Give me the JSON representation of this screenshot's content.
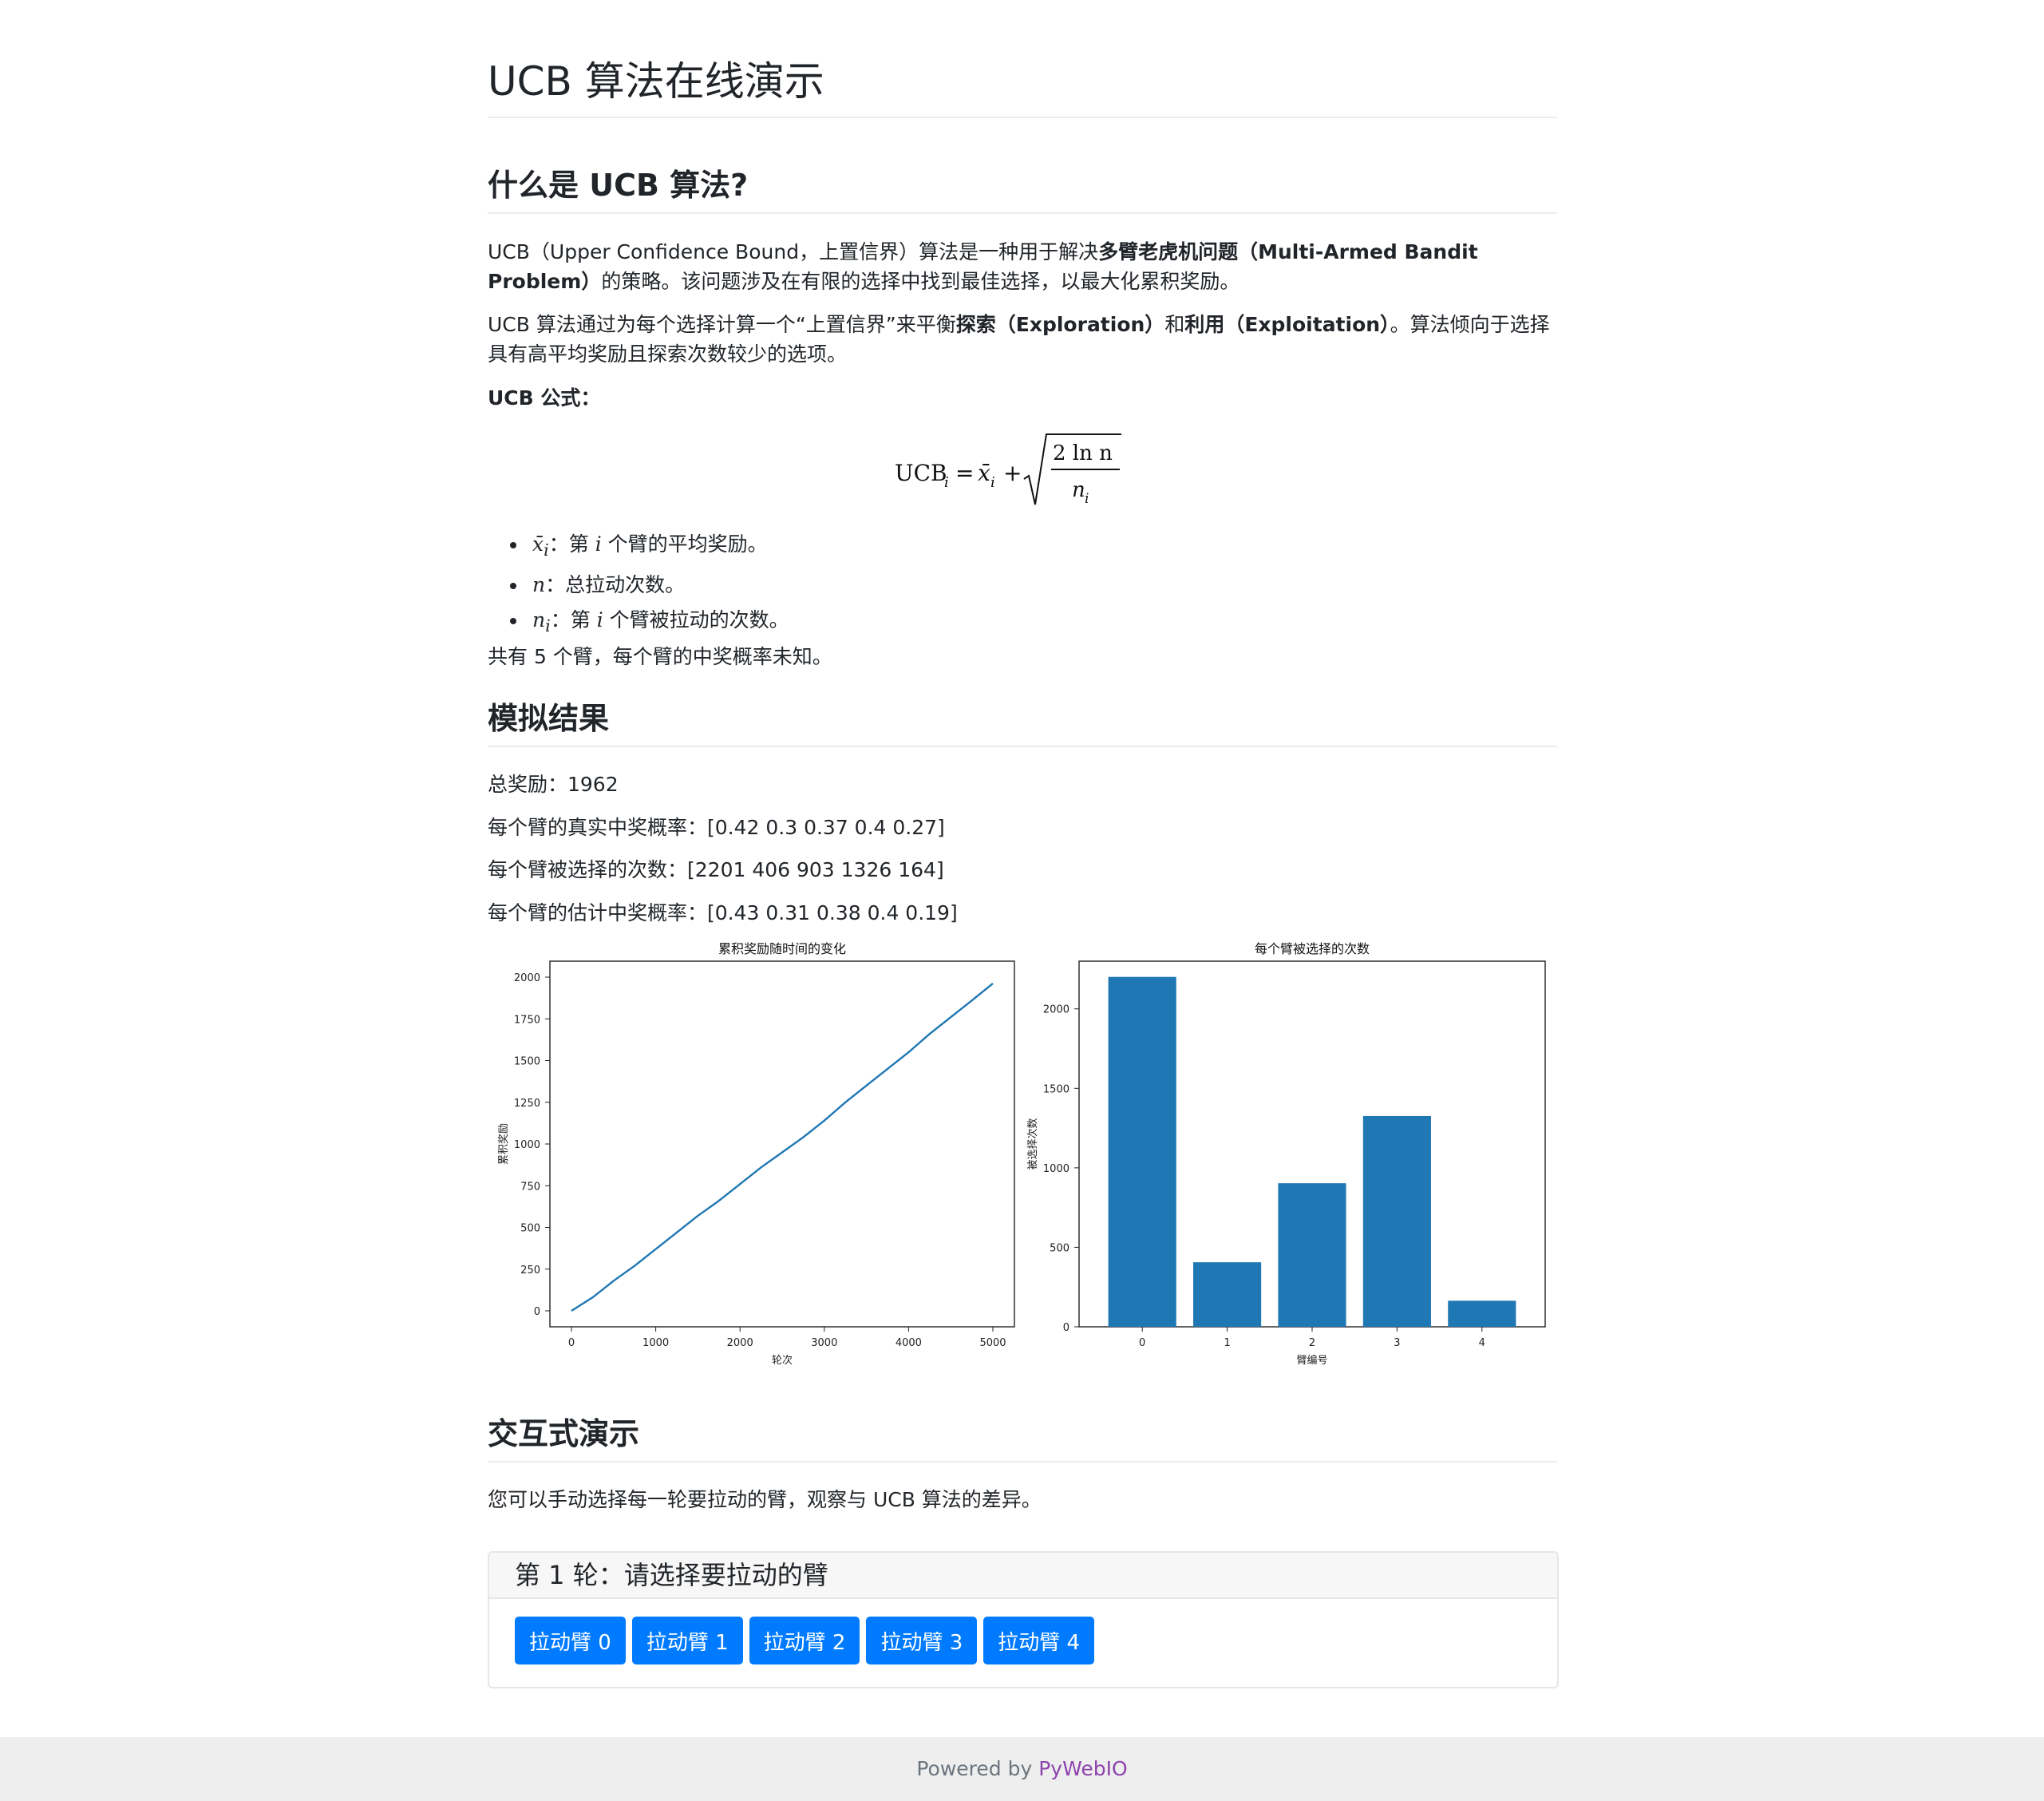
{
  "header": {
    "title": "UCB 算法在线演示"
  },
  "intro": {
    "heading": "什么是 UCB 算法?",
    "p1_a": "UCB（Upper Confidence Bound，上置信界）算法是一种用于解决",
    "p1_bold": "多臂老虎机问题（Multi-Armed Bandit Problem）",
    "p1_b": "的策略。该问题涉及在有限的选择中找到最佳选择，以最大化累积奖励。",
    "p2_a": "UCB 算法通过为每个选择计算一个“上置信界”来平衡",
    "p2_bold1": "探索（Exploration）",
    "p2_b": "和",
    "p2_bold2": "利用（Exploitation）",
    "p2_c": "。算法倾向于选择具有高平均奖励且探索次数较少的选项。",
    "formula_label": "UCB 公式：",
    "formula": {
      "lhs": "UCB",
      "lhs_sub": "i",
      "eq": " = ",
      "xbar": "x̄",
      "xbar_sub": "i",
      "plus": " + ",
      "num": "2 ln n",
      "den": "n",
      "den_sub": "i"
    },
    "vars": [
      {
        "sym": "x̄",
        "sub": "i",
        "text": "：第 ",
        "i": "i",
        "tail": " 个臂的平均奖励。"
      },
      {
        "sym": "n",
        "sub": "",
        "text": "：总拉动次数。",
        "i": "",
        "tail": ""
      },
      {
        "sym": "n",
        "sub": "i",
        "text": "：第 ",
        "i": "i",
        "tail": " 个臂被拉动的次数。"
      }
    ],
    "arms_note": "共有 5 个臂，每个臂的中奖概率未知。"
  },
  "results": {
    "heading": "模拟结果",
    "total_reward": "总奖励：1962",
    "true_probs": "每个臂的真实中奖概率：[0.42 0.3  0.37 0.4  0.27]",
    "counts": "每个臂被选择的次数：[2201  406  903 1326  164]",
    "est_probs": "每个臂的估计中奖概率：[0.43 0.31 0.38 0.4  0.19]"
  },
  "chart_data": [
    {
      "type": "line",
      "title": "累积奖励随时间的变化",
      "xlabel": "轮次",
      "ylabel": "累积奖励",
      "xlim": [
        0,
        5000
      ],
      "ylim": [
        0,
        2000
      ],
      "xticks": [
        0,
        1000,
        2000,
        3000,
        4000,
        5000
      ],
      "yticks": [
        0,
        250,
        500,
        750,
        1000,
        1250,
        1500,
        1750,
        2000
      ],
      "x": [
        0,
        250,
        500,
        750,
        1000,
        1250,
        1500,
        1750,
        2000,
        2250,
        2500,
        2750,
        3000,
        3250,
        3500,
        3750,
        4000,
        4250,
        4500,
        4750,
        5000
      ],
      "y": [
        0,
        80,
        180,
        270,
        370,
        470,
        570,
        660,
        760,
        860,
        950,
        1040,
        1140,
        1250,
        1350,
        1450,
        1550,
        1660,
        1760,
        1860,
        1962
      ],
      "color": "#1f77b4"
    },
    {
      "type": "bar",
      "title": "每个臂被选择的次数",
      "xlabel": "臂编号",
      "ylabel": "被选择次数",
      "categories": [
        "0",
        "1",
        "2",
        "3",
        "4"
      ],
      "values": [
        2201,
        406,
        903,
        1326,
        164
      ],
      "ylim": [
        0,
        2300
      ],
      "yticks": [
        0,
        500,
        1000,
        1500,
        2000
      ],
      "color": "#1f77b4"
    }
  ],
  "interactive": {
    "heading": "交互式演示",
    "desc": "您可以手动选择每一轮要拉动的臂，观察与 UCB 算法的差异。",
    "round_label": "第 1 轮：请选择要拉动的臂",
    "buttons": [
      "拉动臂 0",
      "拉动臂 1",
      "拉动臂 2",
      "拉动臂 3",
      "拉动臂 4"
    ],
    "button_color": "#007bff"
  },
  "footer": {
    "prefix": "Powered by ",
    "link": "PyWebIO"
  }
}
